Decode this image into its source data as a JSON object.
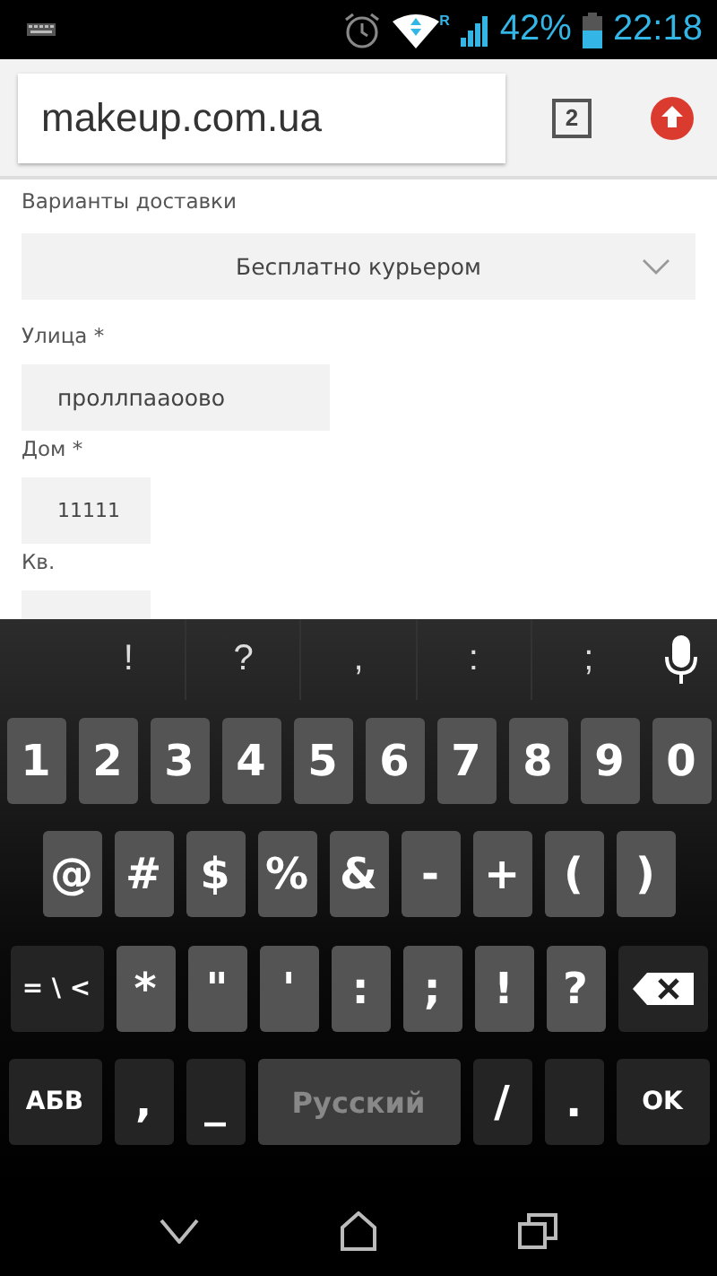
{
  "status_bar": {
    "roaming": "R",
    "battery": "42%",
    "time": "22:18"
  },
  "browser": {
    "url": "makeup.com.ua",
    "tab_count": "2"
  },
  "form": {
    "delivery_label": "Варианты доставки",
    "delivery_value": "Бесплатно курьером",
    "fields": [
      {
        "label": "Улица *",
        "value": "проллпааоово",
        "kind": "wide"
      },
      {
        "label": "Дом *",
        "value": "11111",
        "kind": "short"
      },
      {
        "label": "Кв.",
        "kind": "short"
      }
    ]
  },
  "keyboard": {
    "suggestions": [
      "!",
      "?",
      ",",
      ":",
      ";"
    ],
    "number_row": {
      "keys": [
        {
          "label": "1",
          "kind": "char"
        },
        {
          "label": "2",
          "kind": "char"
        },
        {
          "label": "3",
          "kind": "char"
        },
        {
          "label": "4",
          "kind": "char"
        },
        {
          "label": "5",
          "kind": "char"
        },
        {
          "label": "6",
          "kind": "char"
        },
        {
          "label": "7",
          "kind": "char"
        },
        {
          "label": "8",
          "kind": "char"
        },
        {
          "label": "9",
          "kind": "char"
        },
        {
          "label": "0",
          "kind": "char"
        }
      ]
    },
    "symbol_row": {
      "keys": [
        {
          "label": "@",
          "kind": "char"
        },
        {
          "label": "#",
          "kind": "char"
        },
        {
          "label": "$",
          "kind": "char"
        },
        {
          "label": "%",
          "kind": "char"
        },
        {
          "label": "&",
          "kind": "char"
        },
        {
          "label": "-",
          "kind": "char"
        },
        {
          "label": "+",
          "kind": "char"
        },
        {
          "label": "(",
          "kind": "char"
        },
        {
          "label": ")",
          "kind": "char"
        }
      ]
    },
    "punctuation_row": {
      "keys": [
        {
          "label": "= \\ <",
          "kind": "function"
        },
        {
          "label": "*",
          "kind": "char"
        },
        {
          "label": "\"",
          "kind": "char"
        },
        {
          "label": "'",
          "kind": "char"
        },
        {
          "label": ":",
          "kind": "char"
        },
        {
          "label": ";",
          "kind": "char"
        },
        {
          "label": "!",
          "kind": "char"
        },
        {
          "label": "?",
          "kind": "char"
        },
        {
          "kind": "backspace"
        }
      ]
    },
    "bottom_row": {
      "keys": [
        {
          "label": "АБВ",
          "kind": "function"
        },
        {
          "label": ",",
          "kind": "dark"
        },
        {
          "label": "_",
          "kind": "dark"
        },
        {
          "label": "Русский",
          "kind": "space"
        },
        {
          "label": "/",
          "kind": "dark"
        },
        {
          "label": ".",
          "kind": "dark"
        },
        {
          "label": "OK",
          "kind": "function"
        }
      ]
    }
  }
}
